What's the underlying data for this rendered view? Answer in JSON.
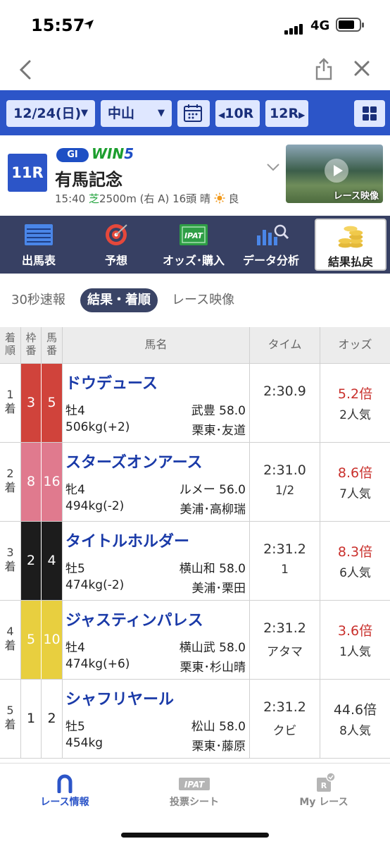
{
  "status_bar": {
    "time": "15:57",
    "network": "4G"
  },
  "race_bar": {
    "date": "12/24(日)",
    "venue": "中山",
    "prev_race": "10R",
    "next_race": "12R"
  },
  "race": {
    "number": "11R",
    "grade": "GI",
    "win5_prefix": "WIN",
    "win5_suffix": "5",
    "name": "有馬記念",
    "start_time": "15:40",
    "surface": "芝",
    "distance": "2500m (右 A) 16頭 晴",
    "going": "良",
    "video_label": "レース映像"
  },
  "tabs": [
    {
      "label": "出馬表",
      "icon": "entry-list-icon"
    },
    {
      "label": "予想",
      "icon": "target-icon"
    },
    {
      "label": "オッズ･購入",
      "icon": "ipat-icon"
    },
    {
      "label": "データ分析",
      "icon": "chart-search-icon"
    },
    {
      "label": "結果払戻",
      "icon": "coins-icon"
    }
  ],
  "sub_tabs": [
    "30秒速報",
    "結果・着順",
    "レース映像"
  ],
  "table": {
    "headers": {
      "pos": "着順",
      "waku": "枠番",
      "uma": "馬番",
      "name": "馬名",
      "time": "タイム",
      "odds": "オッズ"
    },
    "rows": [
      {
        "pos": "1着",
        "waku": "3",
        "uma": "5",
        "waku_color": "#d0433b",
        "waku_text": "#ffffff",
        "name": "ドウデュース",
        "sexage": "牡4",
        "jockey": "武豊 58.0",
        "weight": "506kg(+2)",
        "trainer": "栗東･友道",
        "time": "2:30.9",
        "margin": "",
        "odds": "5.2倍",
        "odds_red": true,
        "popularity": "2人気"
      },
      {
        "pos": "2着",
        "waku": "8",
        "uma": "16",
        "waku_color": "#e07a8e",
        "waku_text": "#ffffff",
        "name": "スターズオンアース",
        "sexage": "牝4",
        "jockey": "ルメー 56.0",
        "weight": "494kg(-2)",
        "trainer": "美浦･高柳瑞",
        "time": "2:31.0",
        "margin": "1/2",
        "odds": "8.6倍",
        "odds_red": true,
        "popularity": "7人気"
      },
      {
        "pos": "3着",
        "waku": "2",
        "uma": "4",
        "waku_color": "#1c1c1c",
        "waku_text": "#ffffff",
        "name": "タイトルホルダー",
        "sexage": "牡5",
        "jockey": "横山和 58.0",
        "weight": "474kg(-2)",
        "trainer": "美浦･栗田",
        "time": "2:31.2",
        "margin": "1",
        "odds": "8.3倍",
        "odds_red": true,
        "popularity": "6人気"
      },
      {
        "pos": "4着",
        "waku": "5",
        "uma": "10",
        "waku_color": "#e8cf3f",
        "waku_text": "#ffffff",
        "name": "ジャスティンパレス",
        "sexage": "牡4",
        "jockey": "横山武 58.0",
        "weight": "474kg(+6)",
        "trainer": "栗東･杉山晴",
        "time": "2:31.2",
        "margin": "アタマ",
        "odds": "3.6倍",
        "odds_red": true,
        "popularity": "1人気"
      },
      {
        "pos": "5着",
        "waku": "1",
        "uma": "2",
        "waku_color": "#ffffff",
        "waku_text": "#222222",
        "name": "シャフリヤール",
        "sexage": "牡5",
        "jockey": "松山 58.0",
        "weight": "454kg",
        "trainer": "栗東･藤原",
        "time": "2:31.2",
        "margin": "クビ",
        "odds": "44.6倍",
        "odds_red": false,
        "popularity": "8人気"
      }
    ]
  },
  "bottom_nav": [
    {
      "label": "レース情報",
      "icon": "horseshoe-icon",
      "active": true
    },
    {
      "label": "投票シート",
      "icon": "ipat-sheet-icon",
      "active": false
    },
    {
      "label": "My レース",
      "icon": "my-race-icon",
      "active": false
    }
  ]
}
